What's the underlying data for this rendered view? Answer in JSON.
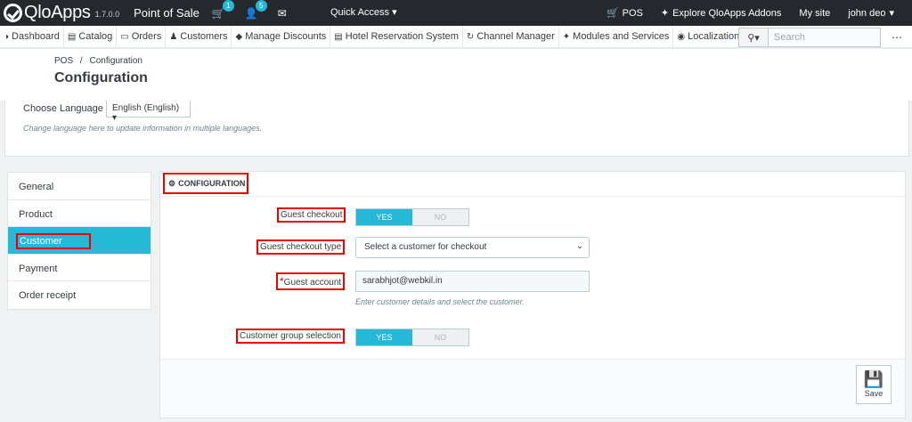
{
  "topbar": {
    "app_name": "QloApps",
    "version": "1.7.0.0",
    "title": "Point of Sale",
    "cart_badge": "1",
    "users_badge": "5",
    "quick_access": "Quick Access",
    "pos": "POS",
    "explore": "Explore QloApps Addons",
    "my_site": "My site",
    "user": "john deo"
  },
  "nav": {
    "items": [
      {
        "label": "Dashboard"
      },
      {
        "label": "Catalog"
      },
      {
        "label": "Orders"
      },
      {
        "label": "Customers"
      },
      {
        "label": "Manage Discounts"
      },
      {
        "label": "Hotel Reservation System"
      },
      {
        "label": "Channel Manager"
      },
      {
        "label": "Modules and Services"
      },
      {
        "label": "Localization"
      }
    ],
    "search_placeholder": "Search"
  },
  "header": {
    "breadcrumb_root": "POS",
    "breadcrumb_sep": "/",
    "breadcrumb_current": "Configuration",
    "title": "Configuration"
  },
  "language": {
    "label": "Choose Language",
    "selected": "English (English)",
    "help": "Change language here to update information in multiple languages."
  },
  "tabs": [
    {
      "label": "General"
    },
    {
      "label": "Product"
    },
    {
      "label": "Customer"
    },
    {
      "label": "Payment"
    },
    {
      "label": "Order receipt"
    }
  ],
  "config": {
    "heading": "CONFIGURATION",
    "guest_checkout_label": "Guest checkout",
    "guest_checkout_type_label": "Guest checkout type",
    "guest_account_req": "*",
    "guest_account_label": "Guest account",
    "customer_group_label": "Customer group selection",
    "yes": "YES",
    "no": "NO",
    "checkout_type_value": "Select a customer for checkout",
    "guest_account_value": "sarabhjot@webkil.in",
    "guest_account_help": "Enter customer details and select the customer.",
    "save": "Save"
  },
  "colors": {
    "accent": "#25b9d7",
    "topbar": "#25292e",
    "highlight": "#ee0000"
  }
}
